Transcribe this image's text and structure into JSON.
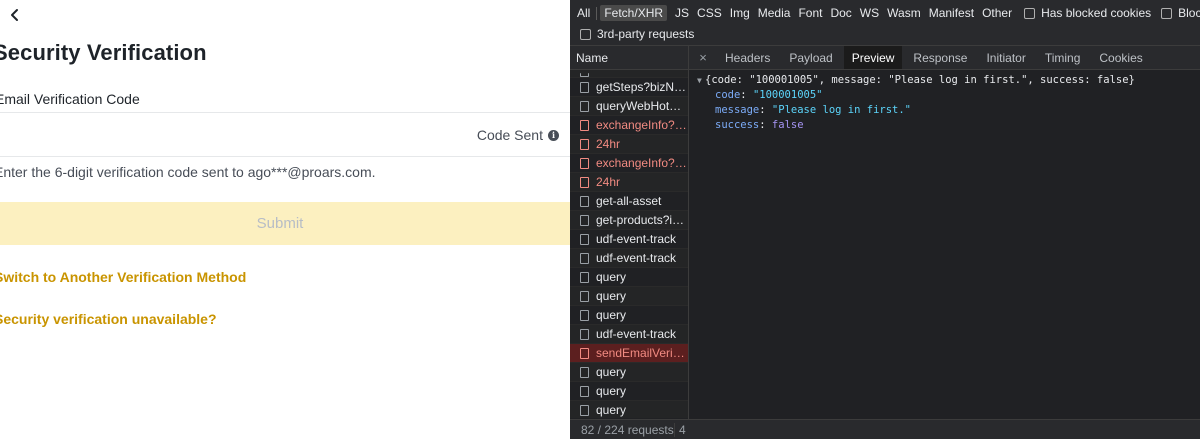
{
  "page": {
    "title": "Security Verification",
    "field_label": "Email Verification Code",
    "code_sent": "Code Sent",
    "hint": "Enter the 6-digit verification code sent to ago***@proars.com.",
    "submit": "Submit",
    "switch_link": "Switch to Another Verification Method",
    "unavailable_link": "Security verification unavailable?"
  },
  "devtools": {
    "filters": [
      "All",
      "Fetch/XHR",
      "JS",
      "CSS",
      "Img",
      "Media",
      "Font",
      "Doc",
      "WS",
      "Wasm",
      "Manifest",
      "Other"
    ],
    "active_filter": "Fetch/XHR",
    "checkbox_blocked_cookies": "Has blocked cookies",
    "checkbox_blocked_requests": "Blocked Re",
    "checkbox_third_party": "3rd-party requests",
    "name_header": "Name",
    "requests": [
      {
        "name": "getSteps?bizNo...",
        "error": false
      },
      {
        "name": "queryWebHotFu...",
        "error": false
      },
      {
        "name": "exchangeInfo?s...",
        "error": true
      },
      {
        "name": "24hr",
        "error": true
      },
      {
        "name": "exchangeInfo?s...",
        "error": true
      },
      {
        "name": "24hr",
        "error": true
      },
      {
        "name": "get-all-asset",
        "error": false
      },
      {
        "name": "get-products?in...",
        "error": false
      },
      {
        "name": "udf-event-track",
        "error": false
      },
      {
        "name": "udf-event-track",
        "error": false
      },
      {
        "name": "query",
        "error": false
      },
      {
        "name": "query",
        "error": false
      },
      {
        "name": "query",
        "error": false
      },
      {
        "name": "udf-event-track",
        "error": false
      },
      {
        "name": "sendEmailVerify...",
        "error": true,
        "selected": true
      },
      {
        "name": "query",
        "error": false
      },
      {
        "name": "query",
        "error": false
      },
      {
        "name": "query",
        "error": false
      }
    ],
    "status_requests": "82 / 224 requests",
    "status_transfer": "4",
    "tabs": [
      "Headers",
      "Payload",
      "Preview",
      "Response",
      "Initiator",
      "Timing",
      "Cookies"
    ],
    "active_tab": "Preview",
    "close_glyph": "×",
    "preview": {
      "summary": "{code: \"100001005\", message: \"Please log in first.\", success: false}",
      "code_key": "code",
      "code_value": "\"100001005\"",
      "message_key": "message",
      "message_value": "\"Please log in first.\"",
      "success_key": "success",
      "success_value": "false"
    }
  }
}
